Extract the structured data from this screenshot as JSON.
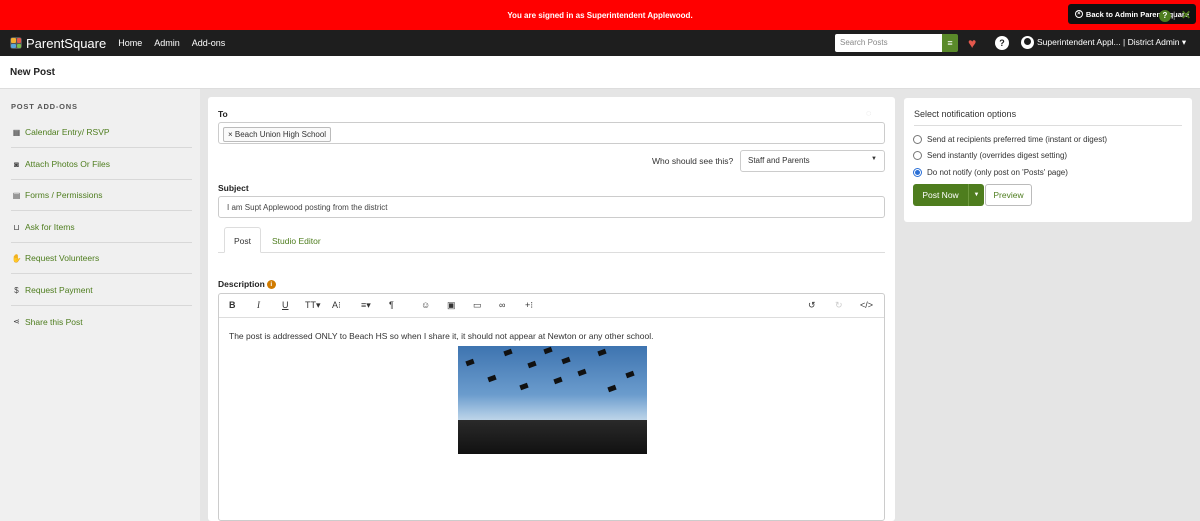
{
  "banner": {
    "text": "You are signed in as Superintendent Applewood.",
    "back_label": "Back to Admin ParentSquare"
  },
  "nav": {
    "logo_text": "ParentSquare",
    "links": [
      "Home",
      "Admin",
      "Add-ons"
    ],
    "search_placeholder": "Search Posts",
    "user_label": "Superintendent Appl... | District Admin ▾",
    "help_glyph": "?"
  },
  "page": {
    "title": "New Post",
    "help_glyph": "?",
    "close_glyph": "✕"
  },
  "sidebar": {
    "heading": "POST ADD-ONS",
    "items": [
      {
        "label": "Calendar Entry/ RSVP",
        "icon": "calendar-icon"
      },
      {
        "label": "Attach Photos Or Files",
        "icon": "camera-icon"
      },
      {
        "label": "Forms / Permissions",
        "icon": "document-icon"
      },
      {
        "label": "Ask for Items",
        "icon": "basket-icon"
      },
      {
        "label": "Request Volunteers",
        "icon": "hand-icon"
      },
      {
        "label": "Request Payment",
        "icon": "dollar-icon"
      },
      {
        "label": "Share this Post",
        "icon": "share-icon"
      }
    ]
  },
  "form": {
    "to_label": "To",
    "recipient_chip": "× Beach Union High School",
    "who_label": "Who should see this?",
    "who_value": "Staff and Parents",
    "subject_label": "Subject",
    "subject_value": "I am Supt Applewood posting from the district",
    "tabs": [
      "Post",
      "Studio Editor"
    ],
    "description_label": "Description",
    "description_info": "i",
    "body_text": "The post is addressed ONLY to Beach HS so when I share it, it should not appear at Newton or any other school."
  },
  "notify": {
    "title": "Select notification options",
    "options": [
      {
        "label": "Send at recipients preferred time (instant or digest)",
        "selected": false
      },
      {
        "label": "Send instantly (overrides digest setting)",
        "selected": false
      },
      {
        "label": "Do not notify (only post on 'Posts' page)",
        "selected": true
      }
    ],
    "post_label": "Post Now",
    "preview_label": "Preview"
  },
  "colors": {
    "banner": "#ff0000",
    "nav": "#1e1e1e",
    "accent": "#4e7d1e"
  }
}
